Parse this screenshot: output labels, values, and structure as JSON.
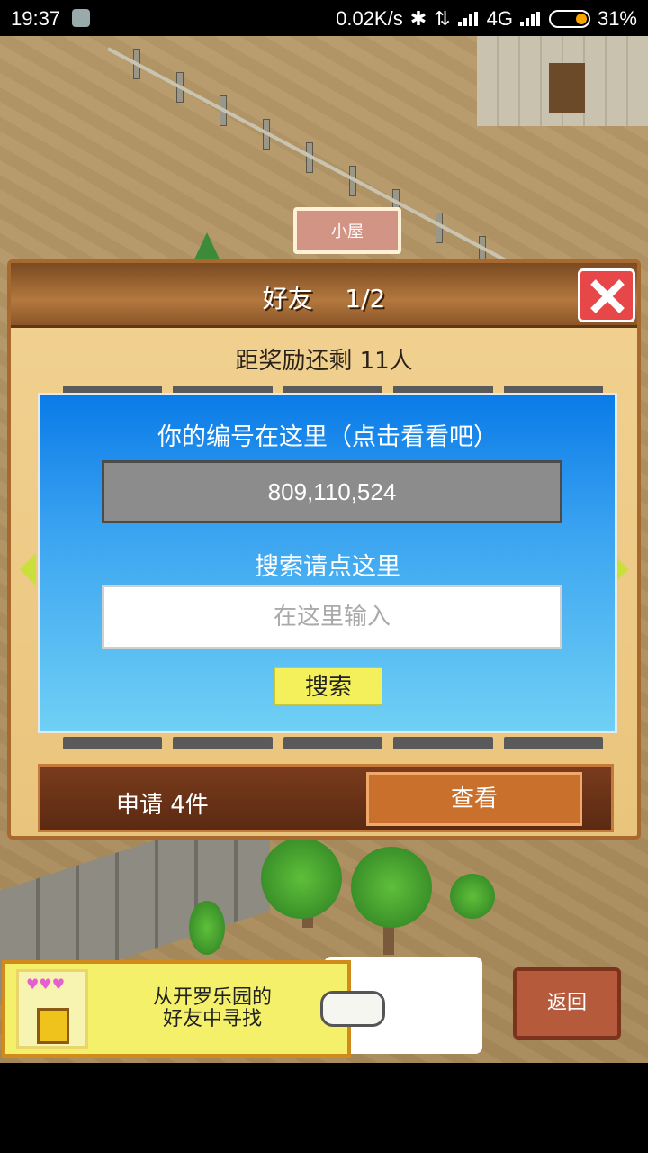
{
  "status_bar": {
    "time": "19:37",
    "net_speed": "0.02K/s",
    "network": "4G",
    "battery": "31%"
  },
  "scene": {
    "house_sign": "小屋"
  },
  "dialog": {
    "title": "好友",
    "page": "1/2",
    "reward_text": "距奖励还剩 11人",
    "id_caption": "你的编号在这里（点击看看吧）",
    "id_value": "809,110,524",
    "search_caption": "搜索请点这里",
    "search_placeholder": "在这里输入",
    "search_button": "搜索",
    "request_text": "申请 4件",
    "view_button": "查看"
  },
  "banner": {
    "line1": "从开罗乐园的",
    "line2": "好友中寻找"
  },
  "back_button": "返回",
  "colors": {
    "panel_blue": "#0a7be8",
    "close_red": "#e8474a",
    "search_yellow": "#f3f05c",
    "header_brown": "#7a4a22"
  }
}
